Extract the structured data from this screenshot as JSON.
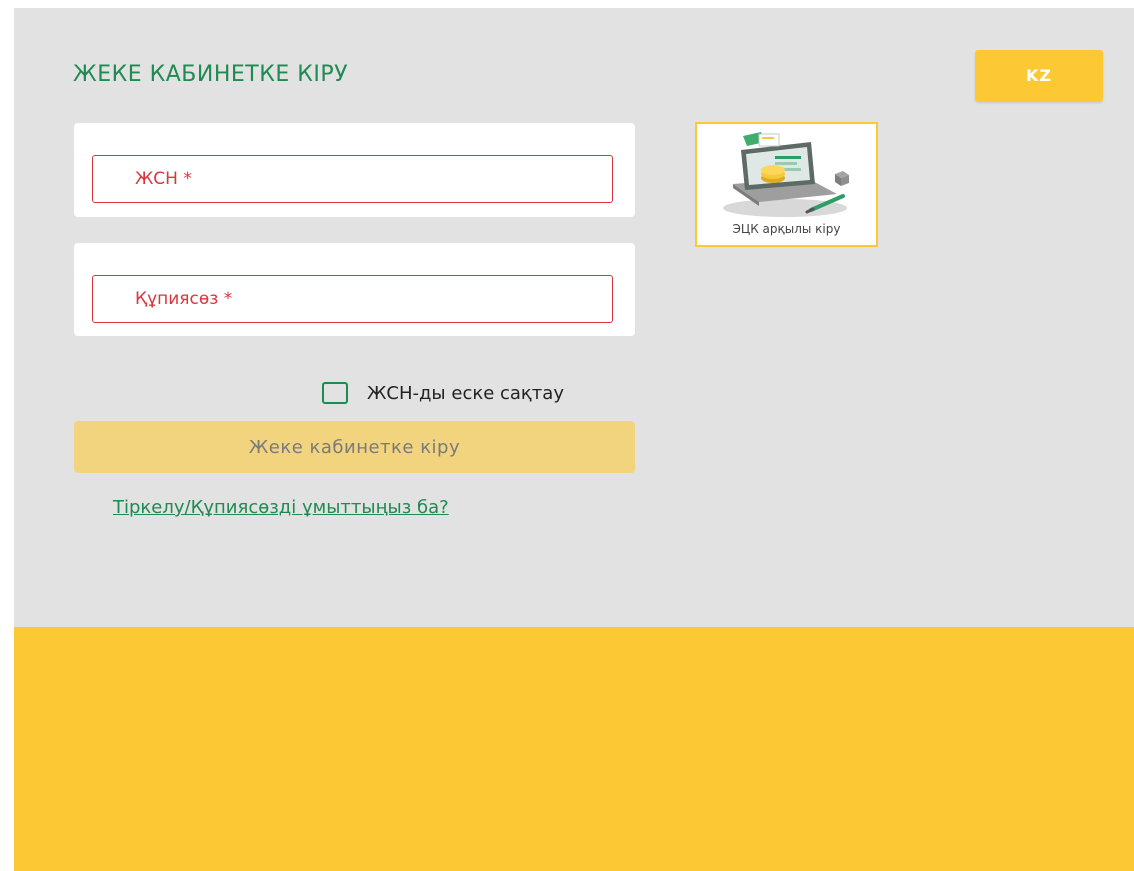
{
  "header": {
    "title": "ЖЕКЕ КАБИНЕТКЕ КІРУ",
    "language_button": "KZ"
  },
  "form": {
    "iin_placeholder": "ЖСН *",
    "password_placeholder": "Құпиясөз *",
    "remember_label": "ЖСН-ды еске сақтау",
    "remember_checked": false,
    "submit_label": "Жеке кабинетке кіру",
    "register_link": "Тіркелу/Құпиясөзді ұмыттыңыз ба?"
  },
  "ecp_login": {
    "label": "ЭЦК арқылы кіру",
    "icon": "computer-ecp-icon"
  },
  "colors": {
    "accent_green": "#1f8a51",
    "brand_yellow": "#fcc934",
    "error_red": "#d9363e",
    "panel_gray": "#e2e2e2"
  }
}
